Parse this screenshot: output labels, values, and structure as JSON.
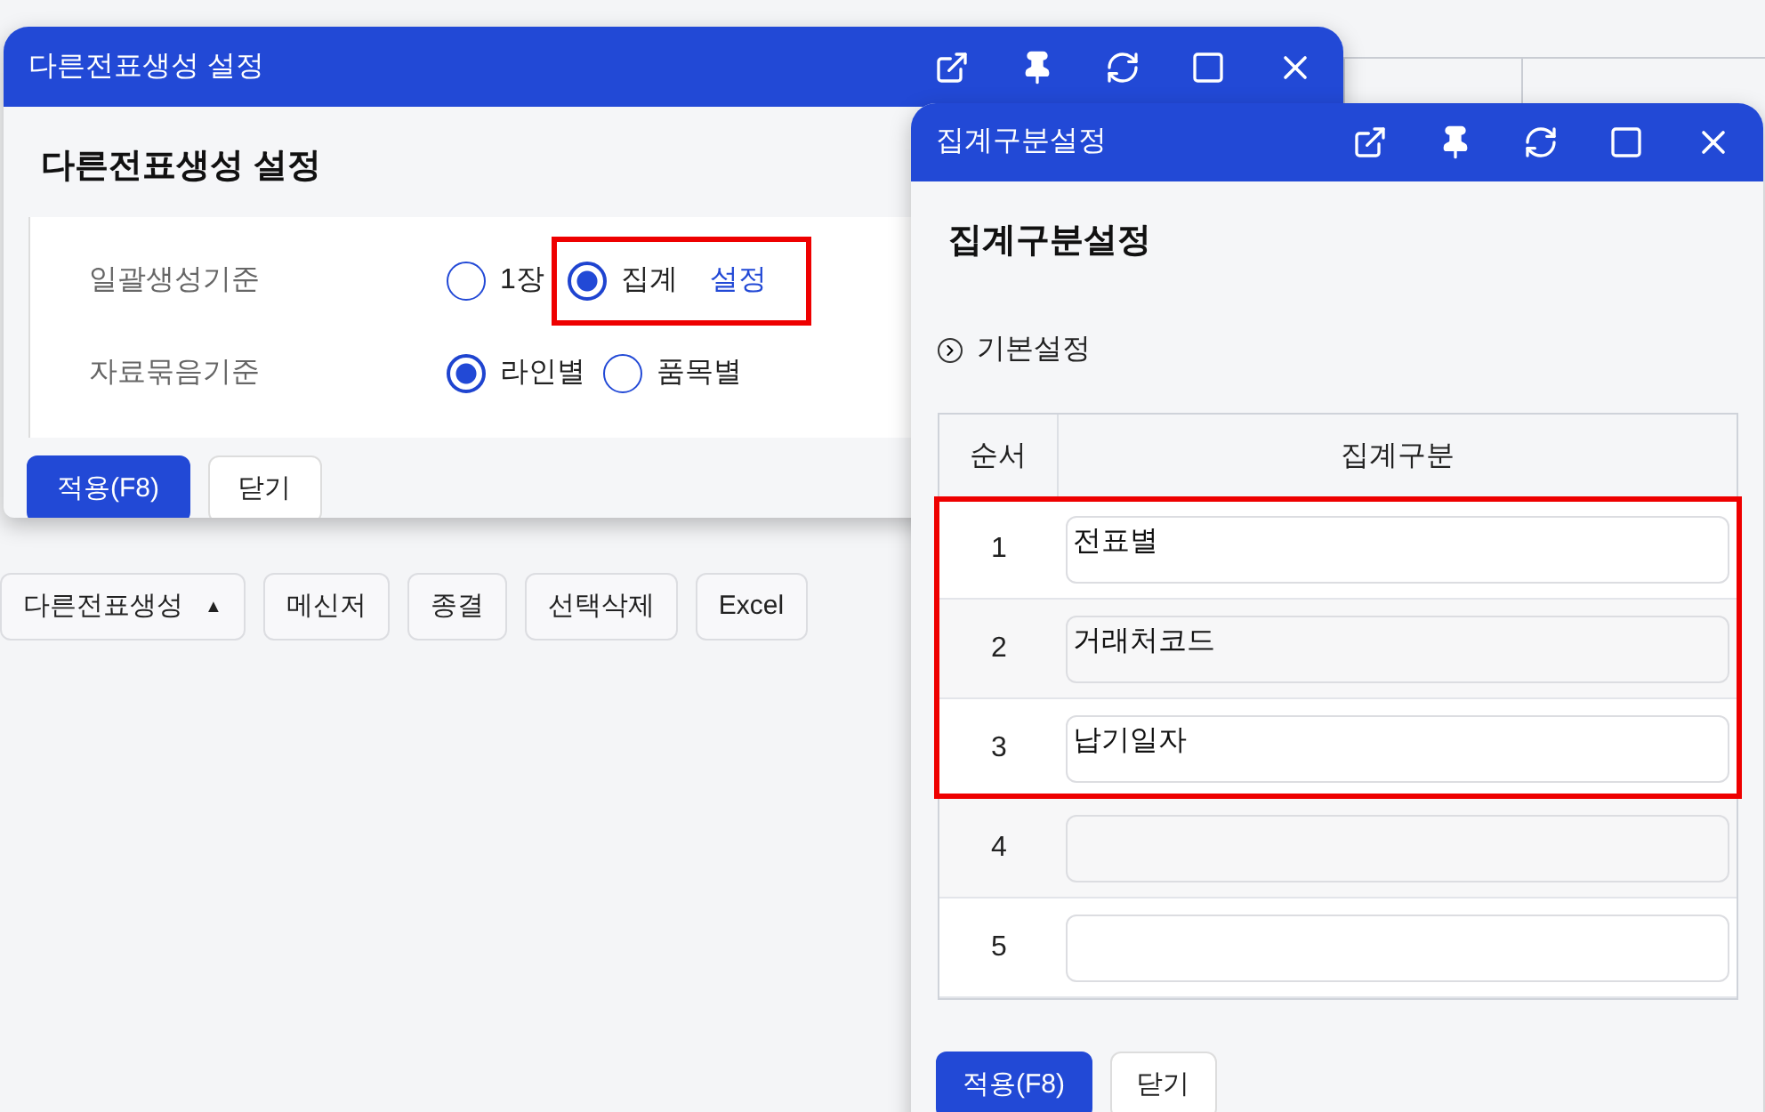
{
  "toolbar": [
    {
      "label": "다른전표생성",
      "caret": "▲"
    },
    {
      "label": "메신저"
    },
    {
      "label": "종결"
    },
    {
      "label": "선택삭제"
    },
    {
      "label": "Excel"
    }
  ],
  "dialog": {
    "title": "다른전표생성 설정",
    "heading": "다른전표생성 설정",
    "fields": [
      {
        "label": "일괄생성기준",
        "options": [
          {
            "label": "1장",
            "selected": false,
            "highlighted": false
          },
          {
            "label": "집계",
            "selected": true,
            "highlighted": true,
            "link": "설정"
          }
        ]
      },
      {
        "label": "자료묶음기준",
        "options": [
          {
            "label": "라인별",
            "selected": true,
            "highlighted": false
          },
          {
            "label": "품목별",
            "selected": false,
            "highlighted": false
          }
        ]
      }
    ],
    "buttons": [
      {
        "label": "적용(F8)",
        "kind": "primary"
      },
      {
        "label": "닫기",
        "kind": "secondary"
      }
    ]
  },
  "subdialog": {
    "title": "집계구분설정",
    "heading": "집계구분설정",
    "section": "기본설정",
    "table": {
      "columns": [
        "순서",
        "집계구분"
      ],
      "rows": [
        {
          "order": "1",
          "value": "전표별",
          "highlighted": true
        },
        {
          "order": "2",
          "value": "거래처코드",
          "highlighted": true
        },
        {
          "order": "3",
          "value": "납기일자",
          "highlighted": true
        },
        {
          "order": "4",
          "value": "",
          "highlighted": false
        },
        {
          "order": "5",
          "value": "",
          "highlighted": false
        }
      ]
    },
    "buttons": [
      {
        "label": "적용(F8)",
        "kind": "primary"
      },
      {
        "label": "닫기",
        "kind": "secondary"
      }
    ]
  }
}
